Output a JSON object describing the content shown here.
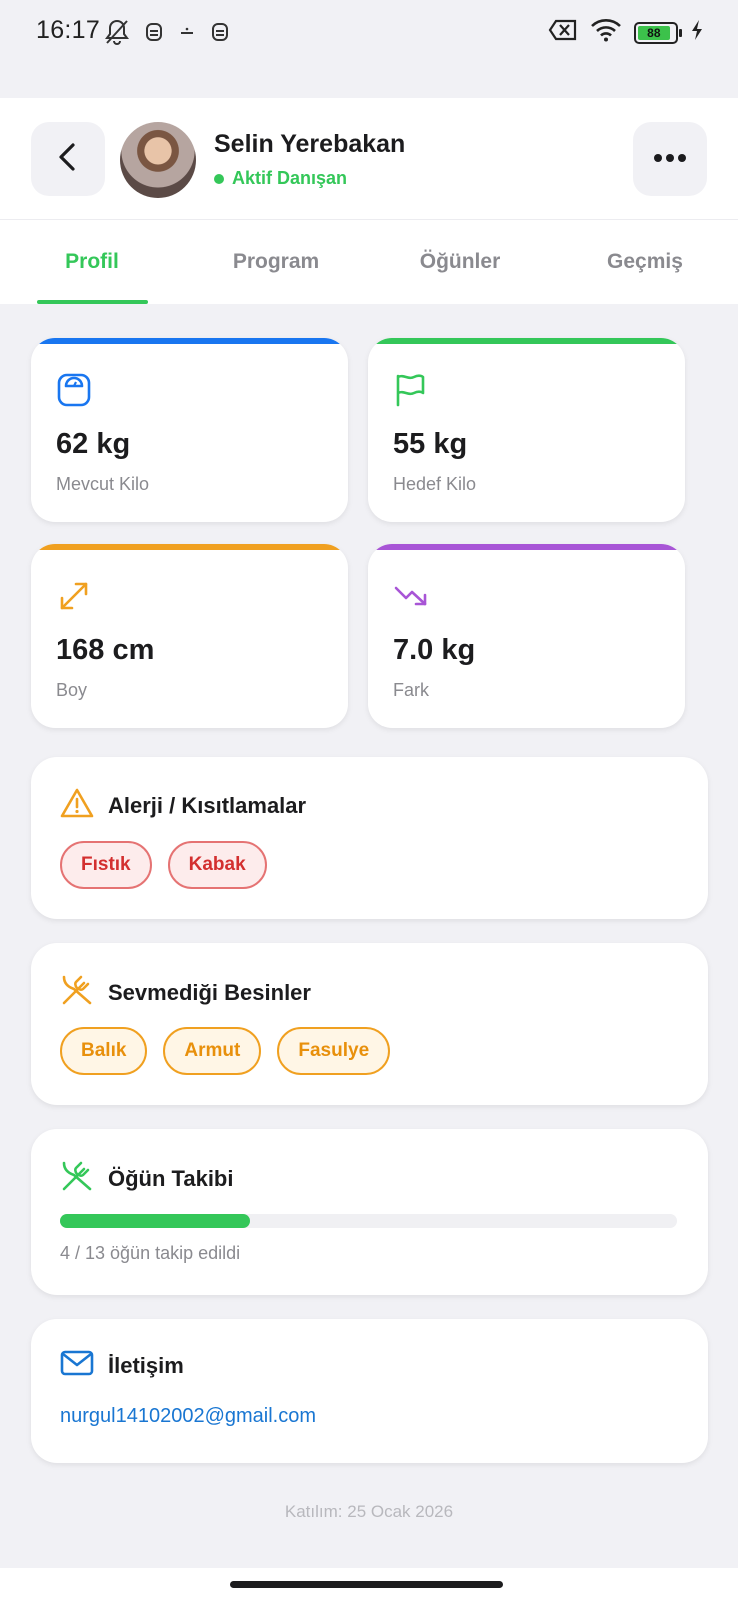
{
  "status_bar": {
    "time": "16:17",
    "battery_level": "88"
  },
  "header": {
    "client_name": "Selin Yerebakan",
    "client_status": "Aktif Danışan"
  },
  "tabs": [
    {
      "label": "Profil",
      "active": true
    },
    {
      "label": "Program",
      "active": false
    },
    {
      "label": "Öğünler",
      "active": false
    },
    {
      "label": "Geçmiş",
      "active": false
    }
  ],
  "stats": [
    {
      "value": "62 kg",
      "label": "Mevcut Kilo",
      "accent": "#1976f0",
      "icon": "scale-icon"
    },
    {
      "value": "55 kg",
      "label": "Hedef Kilo",
      "accent": "#34c759",
      "icon": "flag-icon"
    },
    {
      "value": "168 cm",
      "label": "Boy",
      "accent": "#f0a020",
      "icon": "expand-arrows-icon"
    },
    {
      "value": "7.0 kg",
      "label": "Fark",
      "accent": "#a855d6",
      "icon": "trending-down-icon"
    }
  ],
  "allergies": {
    "title": "Alerji / Kısıtlamalar",
    "items": [
      "Fıstık",
      "Kabak"
    ]
  },
  "dislikes": {
    "title": "Sevmediği Besinler",
    "items": [
      "Balık",
      "Armut",
      "Fasulye"
    ]
  },
  "meal_tracking": {
    "title": "Öğün Takibi",
    "tracked": 4,
    "total": 13,
    "progress_text": "4 / 13 öğün takip edildi"
  },
  "contact": {
    "title": "İletişim",
    "email": "nurgul14102002@gmail.com"
  },
  "joined_text": "Katılım: 25 Ocak 2026",
  "colors": {
    "green": "#34c759",
    "blue": "#1976d2",
    "orange": "#f0a020",
    "red": "#d32f2f",
    "purple": "#a855d6"
  }
}
